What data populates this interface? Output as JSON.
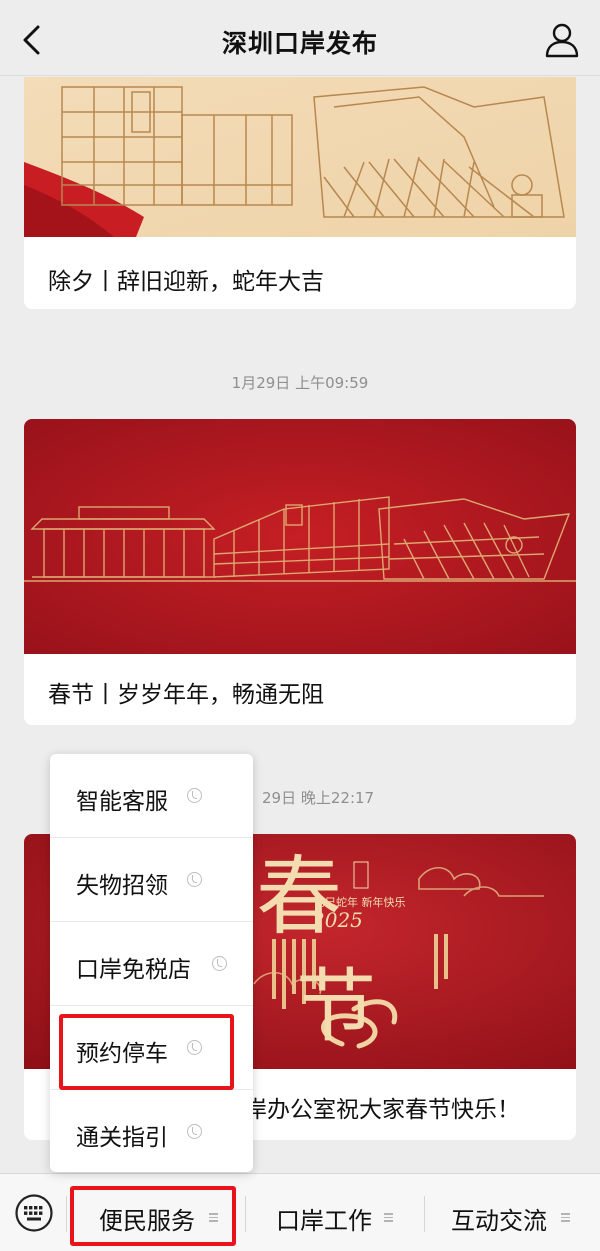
{
  "header": {
    "title": "深圳口岸发布",
    "back_icon": "back-arrow-icon",
    "profile_icon": "person-icon"
  },
  "feed": {
    "cards": [
      {
        "caption": "除夕丨辞旧迎新，蛇年大吉"
      },
      {
        "timestamp": "1月29日 上午09:59",
        "caption": "春节丨岁岁年年，畅通无阻"
      },
      {
        "timestamp": "29日 晚上22:17",
        "caption": "岸办公室祝大家春节快乐！",
        "cover_text": {
          "chun": "春",
          "jie": "节",
          "year": "2025",
          "greeting": "乙巳蛇年 新年快乐"
        }
      }
    ]
  },
  "popup_menu": {
    "items": [
      {
        "label": "智能客服"
      },
      {
        "label": "失物招领"
      },
      {
        "label": "口岸免税店"
      },
      {
        "label": "预约停车"
      },
      {
        "label": "通关指引"
      }
    ]
  },
  "bottom_menu": {
    "keyboard_icon": "keyboard-icon",
    "tabs": [
      {
        "label": "便民服务"
      },
      {
        "label": "口岸工作"
      },
      {
        "label": "互动交流"
      }
    ]
  },
  "colors": {
    "highlight": "#e8141a",
    "festive_red": "#b3141b",
    "gold_line": "#e2b779"
  }
}
